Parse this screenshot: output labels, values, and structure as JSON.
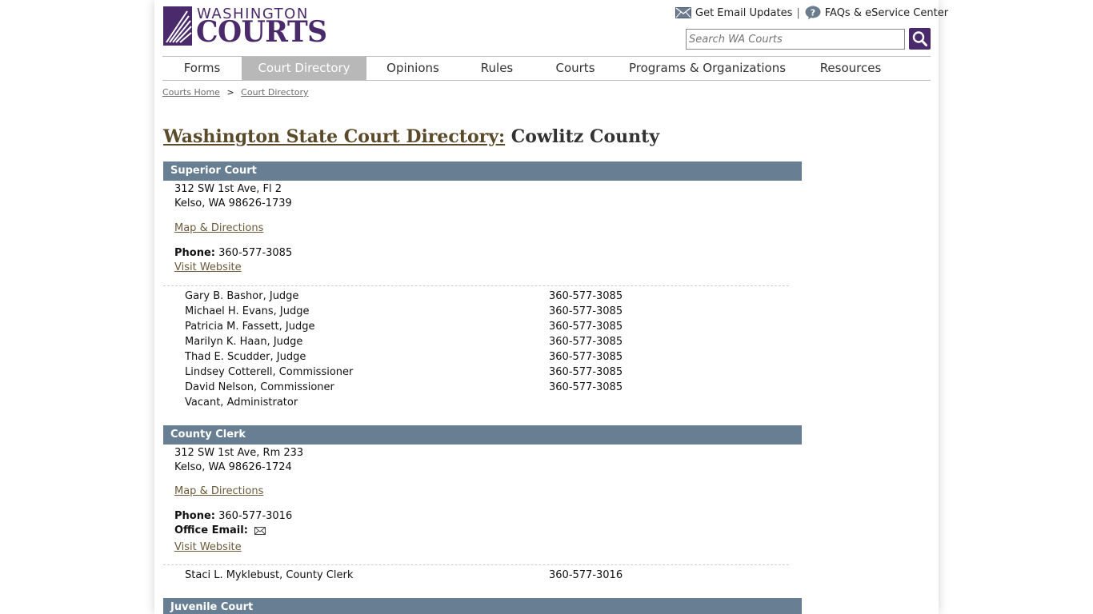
{
  "header": {
    "logo_top": "WASHINGTON",
    "logo_bottom": "COURTS",
    "email_updates": "Get Email Updates",
    "separator": "|",
    "faqs": "FAQs & eService Center",
    "search_placeholder": "Search WA Courts"
  },
  "nav": [
    {
      "label": "Forms"
    },
    {
      "label": "Court Directory",
      "active": true
    },
    {
      "label": "Opinions"
    },
    {
      "label": "Rules"
    },
    {
      "label": "Courts"
    },
    {
      "label": "Programs & Organizations"
    },
    {
      "label": "Resources"
    }
  ],
  "breadcrumb": {
    "home": "Courts Home",
    "sep": ">",
    "current": "Court Directory"
  },
  "page": {
    "title_link": "Washington State Court Directory:",
    "title_county": "Cowlitz County"
  },
  "superior": {
    "heading": "Superior Court",
    "address1": "312 SW 1st Ave, Fl 2",
    "address2": "Kelso, WA 98626-1739",
    "map": "Map & Directions",
    "phone_label": "Phone:",
    "phone": "360-577-3085",
    "website": "Visit Website",
    "people": [
      {
        "name": "Gary B. Bashor, Judge",
        "phone": "360-577-3085"
      },
      {
        "name": "Michael H. Evans, Judge",
        "phone": "360-577-3085"
      },
      {
        "name": "Patricia M. Fassett, Judge",
        "phone": "360-577-3085"
      },
      {
        "name": "Marilyn K. Haan, Judge",
        "phone": "360-577-3085"
      },
      {
        "name": "Thad E. Scudder, Judge",
        "phone": "360-577-3085"
      },
      {
        "name": "Lindsey Cotterell, Commissioner",
        "phone": "360-577-3085"
      },
      {
        "name": "David Nelson, Commissioner",
        "phone": "360-577-3085"
      },
      {
        "name": "Vacant, Administrator",
        "phone": ""
      }
    ]
  },
  "clerk": {
    "heading": "County Clerk",
    "address1": "312 SW 1st Ave, Rm 233",
    "address2": "Kelso, WA 98626-1724",
    "map": "Map & Directions",
    "phone_label": "Phone:",
    "phone": "360-577-3016",
    "email_label": "Office Email:",
    "website": "Visit Website",
    "people": [
      {
        "name": "Staci L. Myklebust, County Clerk",
        "phone": "360-577-3016"
      }
    ]
  },
  "juvenile": {
    "heading": "Juvenile Court"
  },
  "colors": {
    "brand_purple": "#4b2a6b",
    "section_header": "#687e93",
    "nav_active": "#b8b8b8",
    "link": "#6b5a3a"
  }
}
